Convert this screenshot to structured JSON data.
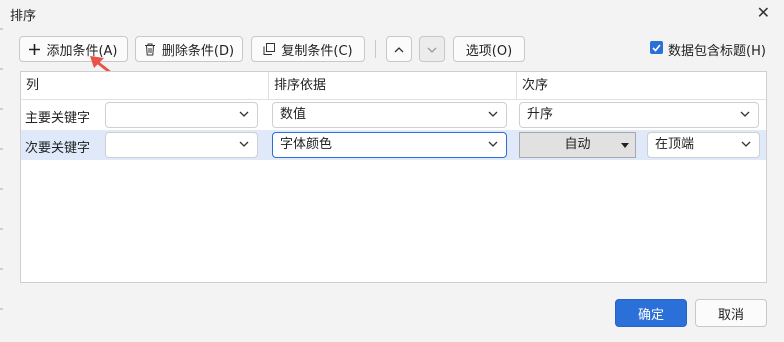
{
  "window": {
    "title": "排序",
    "close_icon": "close-icon"
  },
  "toolbar": {
    "add_label": "添加条件(A)",
    "delete_label": "删除条件(D)",
    "copy_label": "复制条件(C)",
    "options_label": "选项(O)",
    "header_checkbox_label": "数据包含标题(H)",
    "header_checkbox_checked": true
  },
  "grid": {
    "columns": [
      "列",
      "排序依据",
      "次序"
    ],
    "rows": [
      {
        "label": "主要关键字",
        "column_value": "",
        "sort_on": "数值",
        "order": "升序"
      },
      {
        "label": "次要关键字",
        "column_value": "",
        "sort_on": "字体颜色",
        "color_value": "自动",
        "order": "在顶端"
      }
    ]
  },
  "footer": {
    "ok_label": "确定",
    "cancel_label": "取消"
  },
  "colors": {
    "accent": "#2b6fd8",
    "selected_row": "#dfe9f9",
    "annotation_arrow": "#e8534a"
  }
}
